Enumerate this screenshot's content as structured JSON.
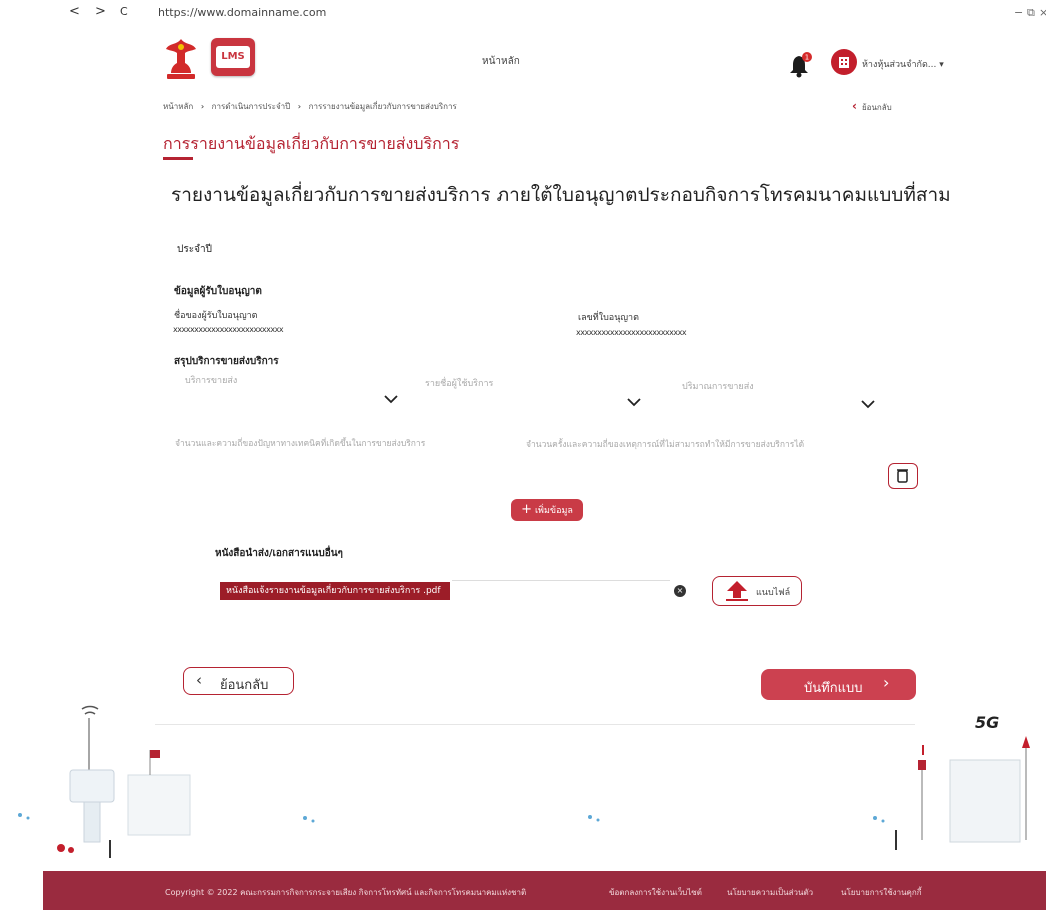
{
  "browser": {
    "url": "https://www.domainname.com",
    "back": "<",
    "forward": ">",
    "reload": "C",
    "minimize": "−",
    "restore": "⧉",
    "close": "×"
  },
  "header": {
    "home_label": "หน้าหลัก",
    "notification_count": "1",
    "user_name": "ห้างหุ้นส่วนจำกัด... ▾",
    "logo2_text": "LMS"
  },
  "breadcrumb": {
    "items": [
      "หน้าหลัก",
      "การดำเนินการประจำปี",
      "การรายงานข้อมูลเกี่ยวกับการขายส่งบริการ"
    ],
    "separator": "›"
  },
  "back_link": "ย้อนกลับ",
  "page_title": "การรายงานข้อมูลเกี่ยวกับการขายส่งบริการ",
  "main_heading": "รายงานข้อมูลเกี่ยวกับการขายส่งบริการ ภายใต้ใบอนุญาตประกอบกิจการโทรคมนาคมแบบที่สาม",
  "form": {
    "period_label": "ประจำปี",
    "licensee_section": "ข้อมูลผู้รับใบอนุญาต",
    "licensee_name_label": "ชื่อของผู้รับใบอนุญาต",
    "licensee_name_value": "xxxxxxxxxxxxxxxxxxxxxxxxxx",
    "license_no_label": "เลขที่ใบอนุญาต",
    "license_no_value": "xxxxxxxxxxxxxxxxxxxxxxxxxx",
    "summary_section": "สรุปบริการขายส่งบริการ",
    "service_placeholder": "บริการขายส่ง",
    "customer_placeholder": "รายชื่อผู้ใช้บริการ",
    "volume_placeholder": "ปริมาณการขายส่ง",
    "problems_placeholder": "จำนวนและความถี่ของปัญหาทางเทคนิคที่เกิดขึ้นในการขายส่งบริการ",
    "failures_placeholder": "จำนวนครั้งและความถี่ของเหตุการณ์ที่ไม่สามารถทำให้มีการขายส่งบริการได้",
    "add_button": "เพิ่มข้อมูล"
  },
  "documents": {
    "label": "หนังสือนำส่ง/เอกสารแนบอื่นๆ",
    "file_name": "หนังสือแจ้งรายงานข้อมูลเกี่ยวกับการขายส่งบริการ .pdf",
    "upload_label": "แนบไฟล์"
  },
  "actions": {
    "back_label": "ย้อนกลับ",
    "save_label": "บันทึกแบบ"
  },
  "illustration": {
    "badge_5g": "5G"
  },
  "footer": {
    "copyright": "Copyright © 2022 คณะกรรมการกิจการกระจายเสียง กิจการโทรทัศน์ และกิจการโทรคมนาคมแห่งชาติ",
    "links": [
      "ข้อตกลงการใช้งานเว็บไซต์",
      "นโยบายความเป็นส่วนตัว",
      "นโยบายการใช้งานคุกกี้"
    ]
  },
  "colors": {
    "primary": "#b52332",
    "button": "#cc4150",
    "footer": "#9a2b3f"
  }
}
